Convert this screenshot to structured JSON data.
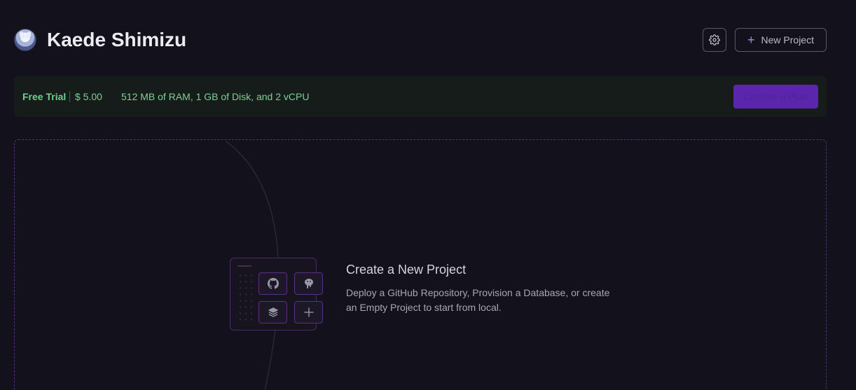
{
  "header": {
    "username": "Kaede Shimizu",
    "avatar_icon": "user-avatar",
    "settings_icon": "gear-icon",
    "new_project_label": "New Project",
    "new_project_icon": "plus-icon"
  },
  "trial": {
    "label": "Free Trial",
    "price": "$ 5.00",
    "resources": "512 MB of RAM, 1 GB of Disk, and 2 vCPU",
    "cta_label": "Choose a Plan"
  },
  "empty_state": {
    "title": "Create a New Project",
    "description": "Deploy a GitHub Repository, Provision a Database, or create an Empty Project to start from local.",
    "tiles": [
      "github-icon",
      "postgres-icon",
      "stack-icon",
      "plus-icon"
    ]
  },
  "colors": {
    "background": "#13111c",
    "accent": "#5b26ad",
    "trial_text": "#6fcf8f",
    "dashed_border": "#5a2e78"
  }
}
